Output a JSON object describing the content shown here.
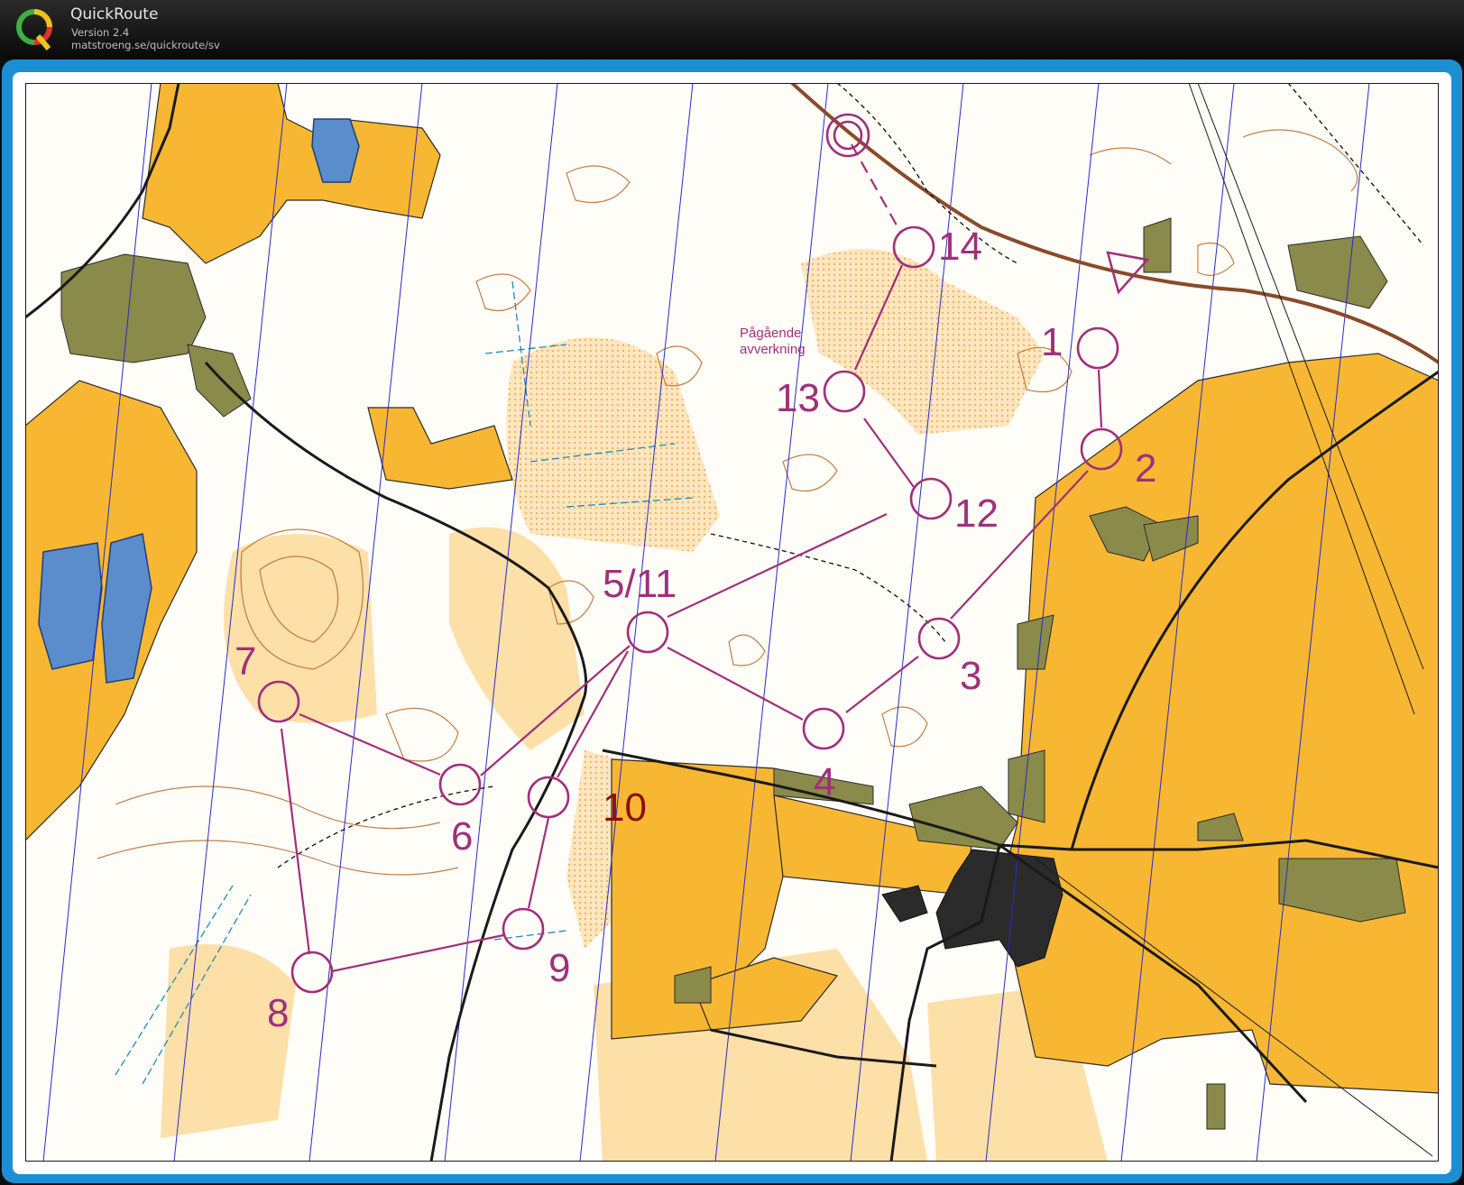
{
  "app": {
    "title": "QuickRoute",
    "version": "Version 2.4",
    "url": "matstroeng.se/quickroute/sv",
    "logo_letter": "Q"
  },
  "colors": {
    "frame_blue": "#1c8fd4",
    "course_purple": "#a0307a",
    "open_land_yellow": "#f7b733",
    "rough_open": "#fddfa8",
    "water_blue": "#5b8ccb",
    "settlement_olive": "#8a8a4a",
    "contour_brown": "#b86a2a"
  },
  "map": {
    "area_note": [
      "Pågående",
      "avverkning"
    ],
    "feature_label_10": "10",
    "controls": [
      {
        "id": "start",
        "label": ""
      },
      {
        "id": "1",
        "label": "1"
      },
      {
        "id": "2",
        "label": "2"
      },
      {
        "id": "3",
        "label": "3"
      },
      {
        "id": "4",
        "label": "4"
      },
      {
        "id": "5",
        "label": "5/11"
      },
      {
        "id": "6",
        "label": "6"
      },
      {
        "id": "7",
        "label": "7"
      },
      {
        "id": "8",
        "label": "8"
      },
      {
        "id": "9",
        "label": "9"
      },
      {
        "id": "12",
        "label": "12"
      },
      {
        "id": "13",
        "label": "13"
      },
      {
        "id": "14",
        "label": "14"
      },
      {
        "id": "finish",
        "label": ""
      }
    ]
  }
}
